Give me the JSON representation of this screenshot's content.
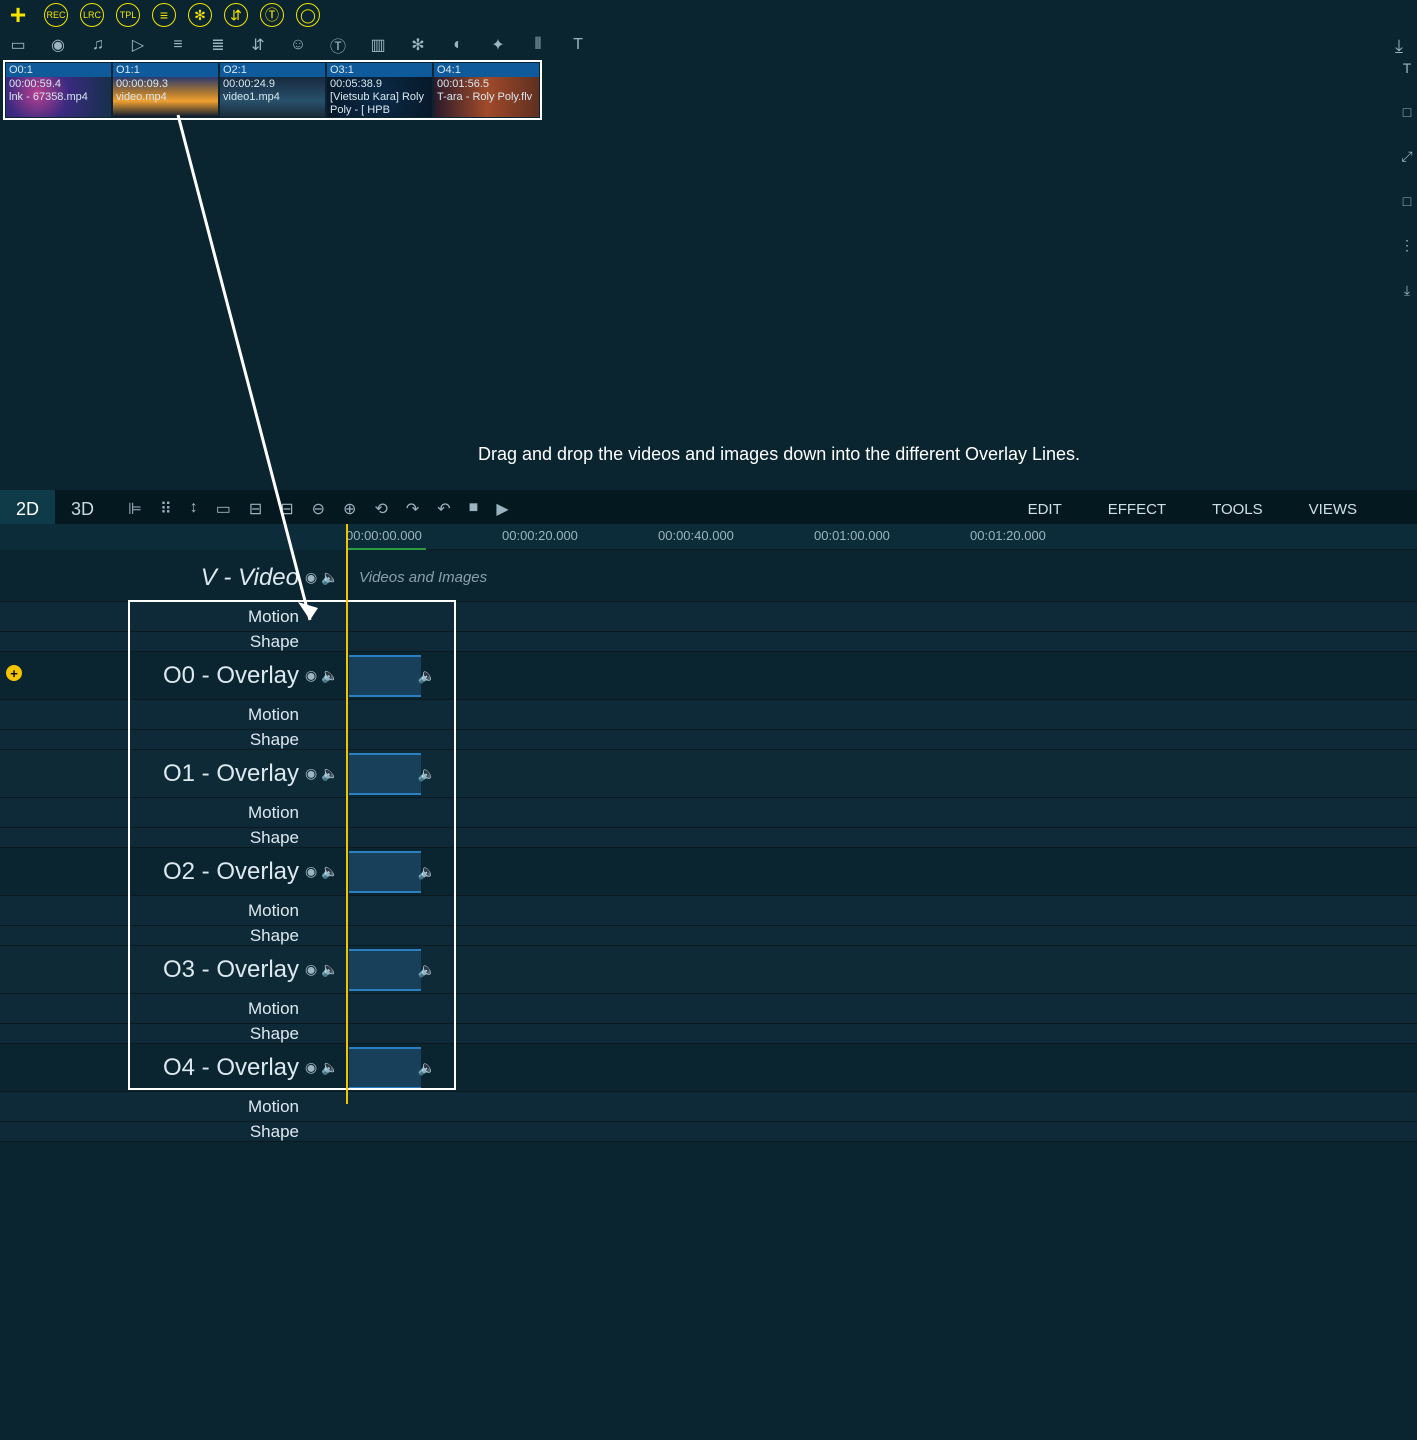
{
  "top_toolbar": {
    "plus": "+",
    "circles": [
      "REC",
      "LRC",
      "TPL",
      "≡",
      "✻",
      "⇵",
      "Ⓣ",
      "◯"
    ]
  },
  "second_toolbar": [
    "▭",
    "◉",
    "♫",
    "▷",
    "≡",
    "≣",
    "⇵",
    "☺",
    "Ⓣ",
    "▥",
    "✻",
    "◐",
    "✦",
    "⫴",
    "T"
  ],
  "right_strip": [
    "T",
    "□",
    "⤢",
    "□",
    "⋮",
    "⤓"
  ],
  "download_glyph": "⤓",
  "media_clips": [
    {
      "id": "O0:1",
      "dur": "00:00:59.4",
      "name": "lnk - 67358.mp4",
      "thumb": "thumb0"
    },
    {
      "id": "O1:1",
      "dur": "00:00:09.3",
      "name": "video.mp4",
      "thumb": "thumb1"
    },
    {
      "id": "O2:1",
      "dur": "00:00:24.9",
      "name": "video1.mp4",
      "thumb": "thumb2"
    },
    {
      "id": "O3:1",
      "dur": "00:05:38.9",
      "name": "[Vietsub Kara] Roly Poly - [ HPB",
      "thumb": "thumb3"
    },
    {
      "id": "O4:1",
      "dur": "00:01:56.5",
      "name": "T-ara - Roly Poly.flv",
      "thumb": "thumb4"
    }
  ],
  "hint": "Drag and drop the videos and images down into the different Overlay Lines.",
  "tabs": {
    "tab2d": "2D",
    "tab3d": "3D"
  },
  "mid_tools": [
    "⊫",
    "⠿",
    "↕",
    "▭",
    "⊟",
    "⊟",
    "⊖",
    "⊕",
    "⟲",
    "↷",
    "↶",
    "■",
    "▶"
  ],
  "menus": {
    "edit": "EDIT",
    "effect": "EFFECT",
    "tools": "TOOLS",
    "views": "VIEWS"
  },
  "ruler": [
    "00:00:00.000",
    "00:00:20.000",
    "00:00:40.000",
    "00:01:00.000",
    "00:01:20.000"
  ],
  "tracks": {
    "video_label": "V - Video",
    "video_placeholder": "Videos and Images",
    "motion": "Motion",
    "shape": "Shape",
    "overlays": [
      {
        "label": "O0 - Overlay",
        "thumb": "thumb0"
      },
      {
        "label": "O1 - Overlay",
        "thumb": "thumb1"
      },
      {
        "label": "O2 - Overlay",
        "thumb": "thumb2"
      },
      {
        "label": "O3 - Overlay",
        "thumb": "thumb3"
      },
      {
        "label": "O4 - Overlay",
        "thumb": "thumb4"
      }
    ]
  },
  "icons": {
    "eye": "◉",
    "speaker": "🔈"
  }
}
